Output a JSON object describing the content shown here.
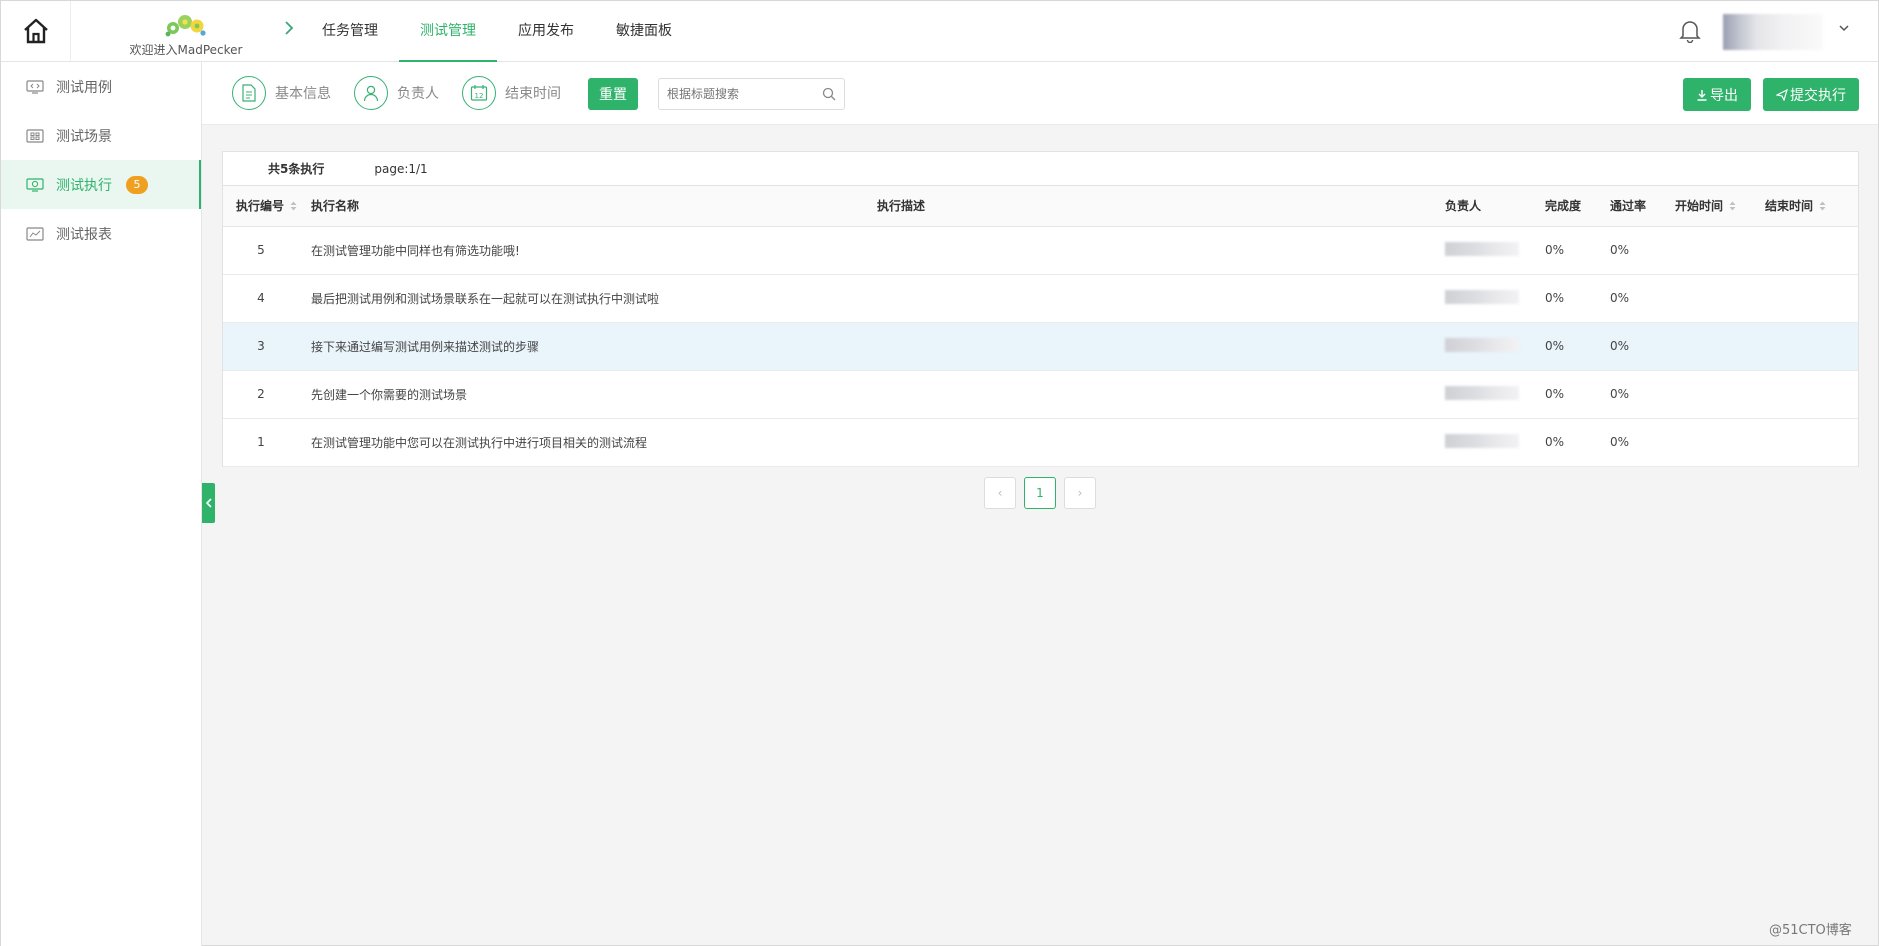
{
  "header": {
    "logo_text": "欢迎进入MadPecker",
    "nav": [
      {
        "label": "任务管理",
        "active": false
      },
      {
        "label": "测试管理",
        "active": true
      },
      {
        "label": "应用发布",
        "active": false
      },
      {
        "label": "敏捷面板",
        "active": false
      }
    ]
  },
  "sidebar": {
    "items": [
      {
        "label": "测试用例",
        "icon": "code-monitor-icon",
        "active": false
      },
      {
        "label": "测试场景",
        "icon": "scene-grid-icon",
        "active": false
      },
      {
        "label": "测试执行",
        "icon": "run-monitor-icon",
        "active": true,
        "badge": "5"
      },
      {
        "label": "测试报表",
        "icon": "chart-icon",
        "active": false
      }
    ]
  },
  "filters": {
    "basic_info": "基本信息",
    "owner": "负责人",
    "end_time": "结束时间",
    "reset": "重置",
    "search_placeholder": "根据标题搜索"
  },
  "actions": {
    "export": "导出",
    "submit": "提交执行"
  },
  "table": {
    "summary": "共5条执行",
    "page_info": "page:1/1",
    "columns": [
      "执行编号",
      "执行名称",
      "执行描述",
      "负责人",
      "完成度",
      "通过率",
      "开始时间",
      "结束时间"
    ],
    "rows": [
      {
        "id": "5",
        "name": "在测试管理功能中同样也有筛选功能哦!",
        "desc": "",
        "completion": "0%",
        "pass_rate": "0%",
        "start": "",
        "end": ""
      },
      {
        "id": "4",
        "name": "最后把测试用例和测试场景联系在一起就可以在测试执行中测试啦",
        "desc": "",
        "completion": "0%",
        "pass_rate": "0%",
        "start": "",
        "end": ""
      },
      {
        "id": "3",
        "name": "接下来通过编写测试用例来描述测试的步骤",
        "desc": "",
        "completion": "0%",
        "pass_rate": "0%",
        "start": "",
        "end": ""
      },
      {
        "id": "2",
        "name": "先创建一个你需要的测试场景",
        "desc": "",
        "completion": "0%",
        "pass_rate": "0%",
        "start": "",
        "end": ""
      },
      {
        "id": "1",
        "name": "在测试管理功能中您可以在测试执行中进行项目相关的测试流程",
        "desc": "",
        "completion": "0%",
        "pass_rate": "0%",
        "start": "",
        "end": ""
      }
    ]
  },
  "pagination": {
    "prev": "‹",
    "current": "1",
    "next": "›"
  },
  "watermark": "@51CTO博客",
  "colors": {
    "accent": "#2fb36b",
    "badge": "#f0a021",
    "row_highlight": "#eaf4fb"
  }
}
